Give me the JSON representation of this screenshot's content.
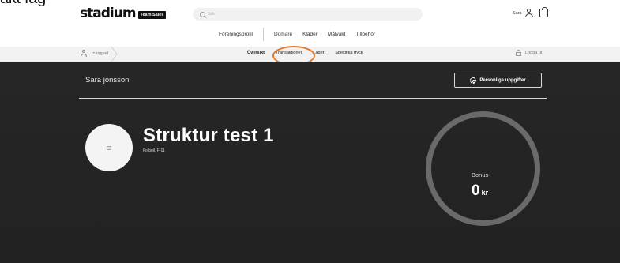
{
  "header": {
    "cut_text": "akt fag",
    "logo_word": "stadium",
    "logo_badge": "Team Sales",
    "search_placeholder": "Sök",
    "user_name": "Sara"
  },
  "category_nav": {
    "items": [
      "Föreningsprofil",
      "Domare",
      "Kläder",
      "Målvakt",
      "Tillbehör"
    ]
  },
  "sub_nav": {
    "logged_in_label": "Inloggad",
    "tabs": [
      "Översikt",
      "Transaktioner",
      "Laget",
      "Specifika tryck"
    ],
    "active_tab": "Översikt",
    "logout_label": "Logga ut"
  },
  "annotation": {
    "highlight_color": "#e8782a",
    "highlighted_tab": "Transaktioner"
  },
  "main": {
    "profile_name": "Sara jonsson",
    "personal_button_label": "Personliga uppgifter",
    "team_title": "Struktur test 1",
    "team_subtitle": "Fotboll, F-11",
    "bonus_label": "Bonus",
    "bonus_value": "0",
    "bonus_unit": "kr"
  },
  "colors": {
    "dark_background": "#262626",
    "subnav_background": "#f2f2f2",
    "ring": "#6a6a6a"
  }
}
